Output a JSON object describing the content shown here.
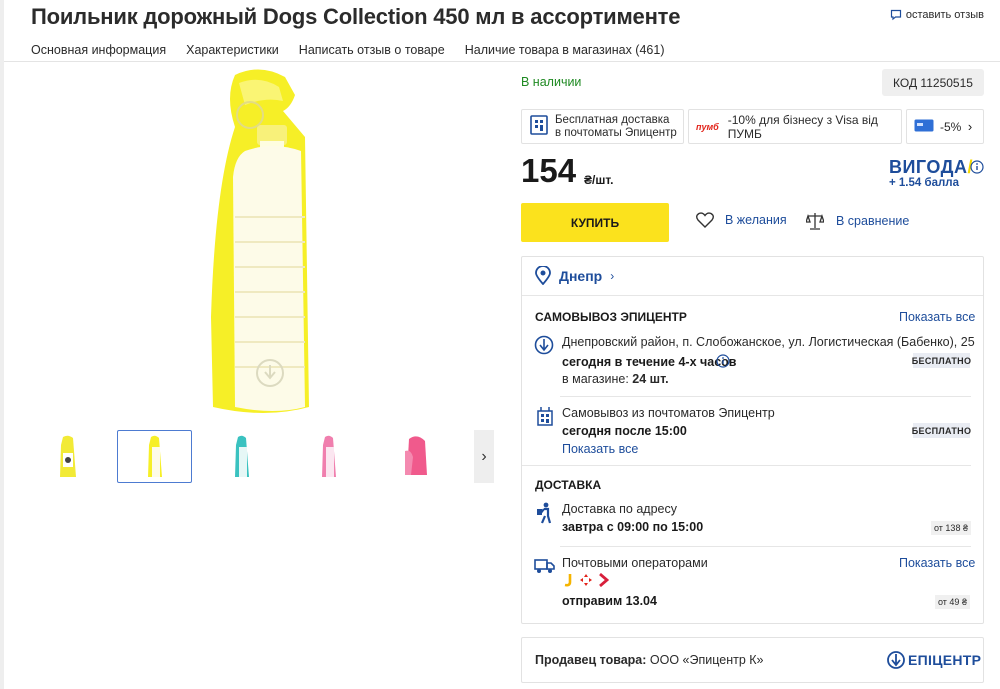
{
  "product": {
    "title": "Поильник дорожный Dogs Collection 450 мл в ассортименте",
    "review_link": "оставить отзыв",
    "availability": "В наличии",
    "code": "КОД 11250515",
    "price": "154",
    "price_unit": "₴/шт.",
    "buy_label": "КУПИТЬ",
    "wishlist_label": "В желания",
    "compare_label": "В сравнение"
  },
  "tabs": [
    "Основная информация",
    "Характеристики",
    "Написать отзыв о товаре",
    "Наличие товара в магазинах (461)"
  ],
  "promos": [
    {
      "icon": "parcel-locker-icon",
      "text_line1": "Бесплатная доставка",
      "text_line2": "в почтоматы Эпицентр"
    },
    {
      "icon": "pumb-logo",
      "logo_text": "пумб",
      "text": "-10% для бізнесу з Visa від ПУМБ"
    },
    {
      "icon": "card-icon",
      "text": "-5%"
    }
  ],
  "bonus": {
    "brand": "ВИГОДА",
    "points": "+ 1.54 балла"
  },
  "delivery": {
    "city": "Днепр",
    "pickup_title": "САМОВЫВОЗ ЭПИЦЕНТР",
    "show_all": "Показать все",
    "store_address": "Днепровский район, п. Слобожанское, ул. Логистическая (Бабенко), 25",
    "store_time": "сегодня в течение 4-х часов",
    "store_stock_label": "в магазине:",
    "store_stock_value": "24 шт.",
    "free_badge": "БЕСПЛАТНО",
    "locker_title": "Самовывоз из почтоматов Эпицентр",
    "locker_time": "сегодня после 15:00",
    "locker_show_all": "Показать все",
    "delivery_title": "ДОСТАВКА",
    "address_delivery": "Доставка по адресу",
    "address_time": "завтра с 09:00 по 15:00",
    "address_cost": "от 138 ₴",
    "post_operators": "Почтовыми операторами",
    "post_show_all": "Показать все",
    "post_send": "отправим 13.04",
    "post_cost": "от 49 ₴"
  },
  "seller": {
    "label": "Продавец товара:",
    "name": "ООО «Эпицентр К»",
    "logo": "ЕПІЦЕНТР"
  },
  "colors": {
    "accent_blue": "#1e4d9b",
    "buy_yellow": "#fbe21d",
    "instock_green": "#1f8a22",
    "thumb_selected": "#4d7bd1"
  },
  "thumbnails": [
    "yellow-bottle-with-dog-label",
    "yellow-bottle",
    "teal-bottle",
    "pink-bottle",
    "pink-bottle-open"
  ]
}
